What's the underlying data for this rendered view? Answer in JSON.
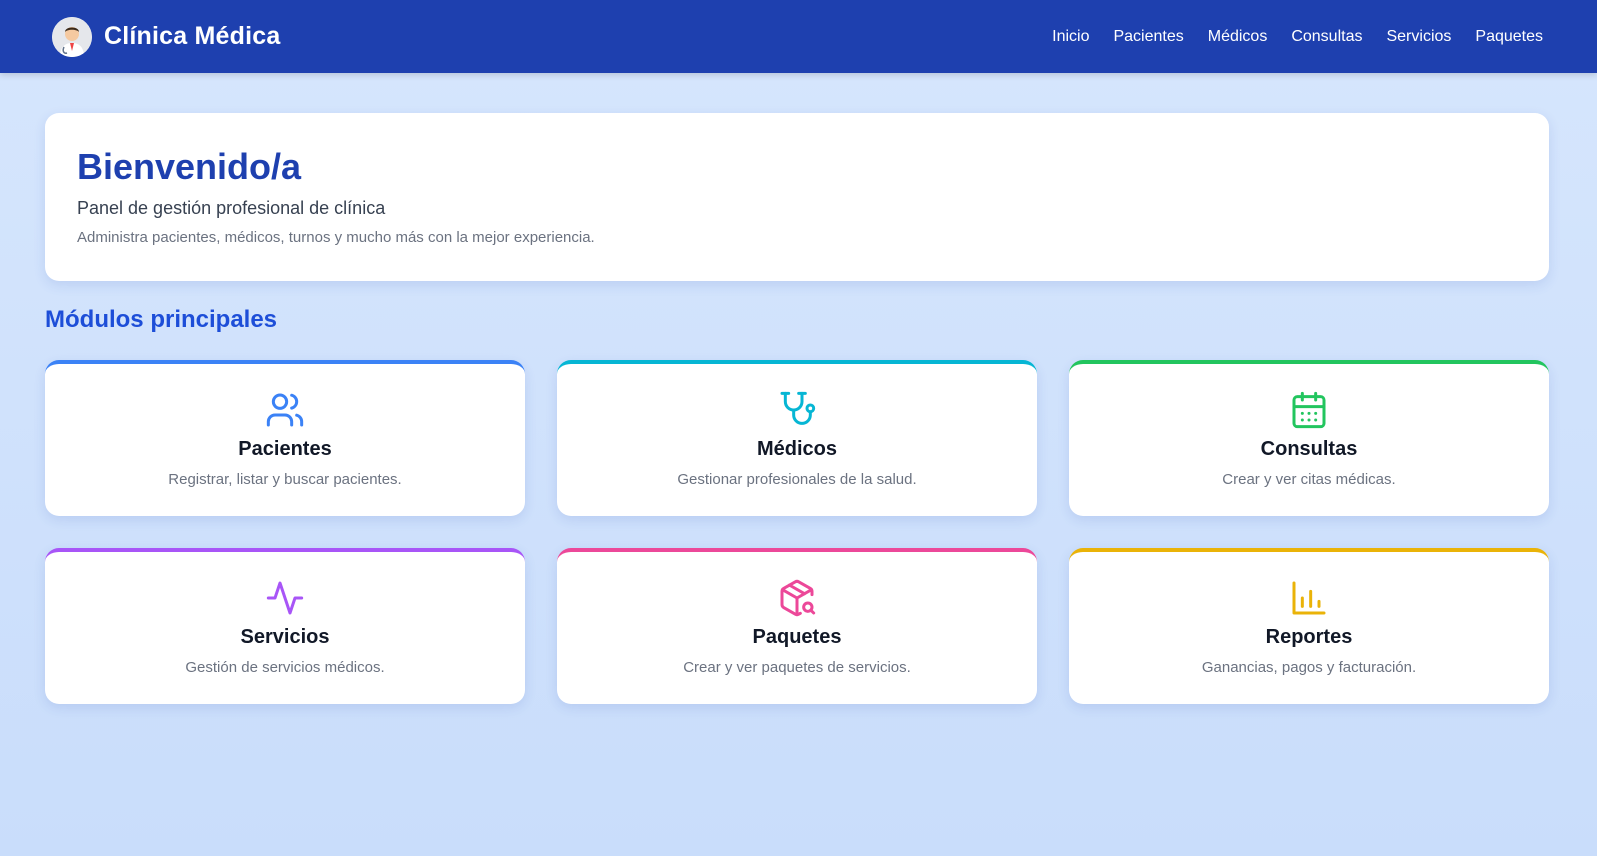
{
  "header": {
    "brand_title": "Clínica Médica",
    "logo_icon": "doctor-avatar-icon",
    "nav": [
      {
        "label": "Inicio"
      },
      {
        "label": "Pacientes"
      },
      {
        "label": "Médicos"
      },
      {
        "label": "Consultas"
      },
      {
        "label": "Servicios"
      },
      {
        "label": "Paquetes"
      }
    ]
  },
  "hero": {
    "title": "Bienvenido/a",
    "subtitle": "Panel de gestión profesional de clínica",
    "description": "Administra pacientes, médicos, turnos y mucho más con la mejor experiencia."
  },
  "modules": {
    "title": "Módulos principales",
    "cards": [
      {
        "title": "Pacientes",
        "description": "Registrar, listar y buscar pacientes.",
        "icon": "users-icon",
        "accent": "#3b82f6"
      },
      {
        "title": "Médicos",
        "description": "Gestionar profesionales de la salud.",
        "icon": "stethoscope-icon",
        "accent": "#06b6d4"
      },
      {
        "title": "Consultas",
        "description": "Crear y ver citas médicas.",
        "icon": "calendar-icon",
        "accent": "#22c55e"
      },
      {
        "title": "Servicios",
        "description": "Gestión de servicios médicos.",
        "icon": "activity-icon",
        "accent": "#a855f7"
      },
      {
        "title": "Paquetes",
        "description": "Crear y ver paquetes de servicios.",
        "icon": "package-search-icon",
        "accent": "#ec4899"
      },
      {
        "title": "Reportes",
        "description": "Ganancias, pagos y facturación.",
        "icon": "bar-chart-icon",
        "accent": "#eab308"
      }
    ]
  },
  "colors": {
    "navbar": "#1e40af",
    "primary_text": "#1e40af",
    "section_title": "#1d4ed8"
  }
}
